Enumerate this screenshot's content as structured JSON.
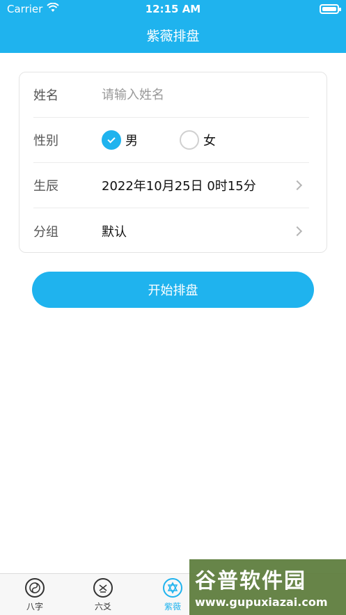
{
  "status_bar": {
    "carrier": "Carrier",
    "time": "12:15 AM"
  },
  "nav": {
    "title": "紫薇排盘"
  },
  "form": {
    "name": {
      "label": "姓名",
      "placeholder": "请输入姓名",
      "value": ""
    },
    "gender": {
      "label": "性别",
      "options": [
        {
          "label": "男",
          "selected": true
        },
        {
          "label": "女",
          "selected": false
        }
      ]
    },
    "birth": {
      "label": "生辰",
      "value": "2022年10月25日 0时15分"
    },
    "group": {
      "label": "分组",
      "value": "默认"
    }
  },
  "actions": {
    "start_label": "开始排盘"
  },
  "tabbar": {
    "tabs": [
      {
        "label": "八字",
        "icon": "bagua-icon",
        "active": false
      },
      {
        "label": "六爻",
        "icon": "liuyao-icon",
        "active": false
      },
      {
        "label": "紫薇",
        "icon": "star-of-david-icon",
        "active": true
      }
    ]
  },
  "watermark": {
    "title": "谷普软件园",
    "url": "www.gupuxiazai.com"
  },
  "colors": {
    "primary": "#1fb3ee"
  }
}
